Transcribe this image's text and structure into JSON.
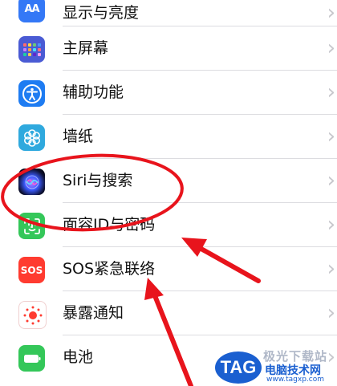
{
  "settings": {
    "items": [
      {
        "label": "显示与亮度",
        "icon": "display-brightness-icon",
        "icon_text": "AA"
      },
      {
        "label": "主屏幕",
        "icon": "home-screen-icon"
      },
      {
        "label": "辅助功能",
        "icon": "accessibility-icon"
      },
      {
        "label": "墙纸",
        "icon": "wallpaper-icon"
      },
      {
        "label": "Siri与搜索",
        "icon": "siri-icon"
      },
      {
        "label": "面容ID与密码",
        "icon": "face-id-icon"
      },
      {
        "label": "SOS紧急联络",
        "icon": "sos-icon",
        "icon_text": "SOS"
      },
      {
        "label": "暴露通知",
        "icon": "exposure-notification-icon"
      },
      {
        "label": "电池",
        "icon": "battery-icon"
      }
    ],
    "chevron": "›"
  },
  "annotation": {
    "color": "#e8141c"
  },
  "watermark": {
    "badge": "TAG",
    "top_text": "极光下载站",
    "name": "电脑技术网",
    "url": "www.tagxp.com"
  }
}
